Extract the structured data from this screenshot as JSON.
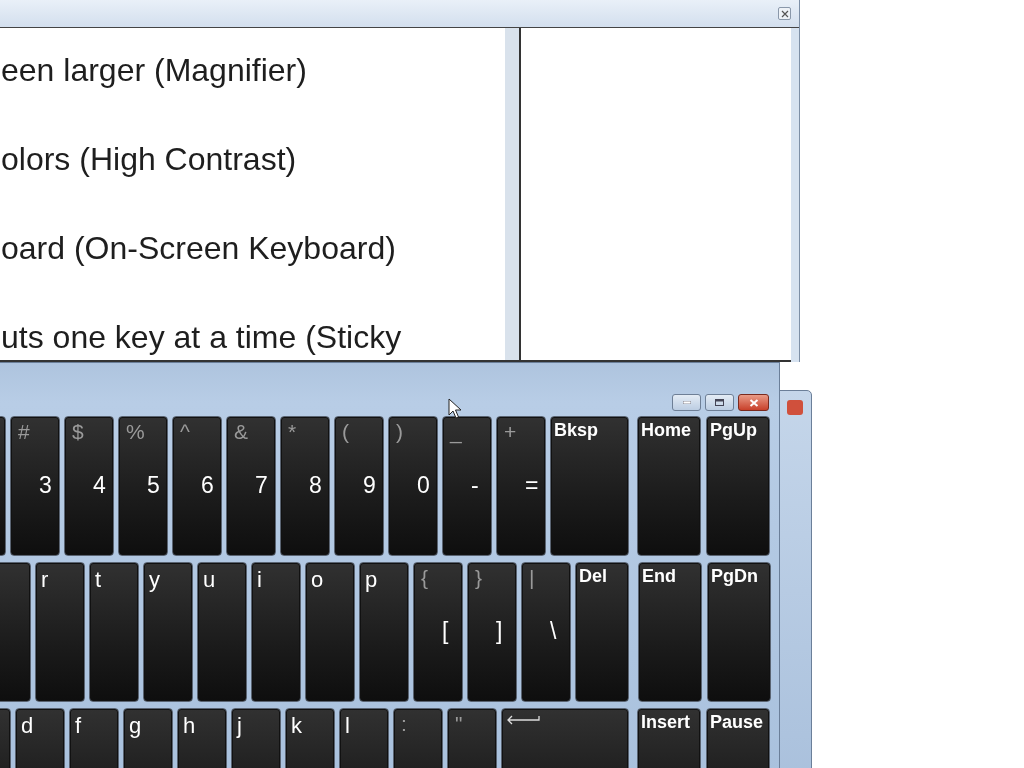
{
  "ease_window": {
    "options": [
      {
        "label": "een larger (Magnifier)"
      },
      {
        "label": "olors (High Contrast)"
      },
      {
        "label": "oard (On-Screen Keyboard)"
      },
      {
        "label": "uts one key at a time (Sticky"
      }
    ]
  },
  "keyboard_window": {
    "rows": [
      {
        "keys": [
          {
            "kind": "blank"
          },
          {
            "kind": "symbol",
            "shift": "#",
            "label": "3"
          },
          {
            "kind": "symbol",
            "shift": "$",
            "label": "4"
          },
          {
            "kind": "symbol",
            "shift": "%",
            "label": "5"
          },
          {
            "kind": "symbol",
            "shift": "^",
            "label": "6"
          },
          {
            "kind": "symbol",
            "shift": "&",
            "label": "7"
          },
          {
            "kind": "symbol",
            "shift": "*",
            "label": "8"
          },
          {
            "kind": "symbol",
            "shift": "(",
            "label": "9"
          },
          {
            "kind": "symbol",
            "shift": ")",
            "label": "0"
          },
          {
            "kind": "symbol",
            "shift": "_",
            "label": "-"
          },
          {
            "kind": "symbol",
            "shift": "+",
            "label": "="
          },
          {
            "kind": "function",
            "label": "Bksp"
          }
        ],
        "nav": [
          {
            "kind": "function",
            "label": "Home"
          },
          {
            "kind": "function",
            "label": "PgUp"
          }
        ]
      },
      {
        "keys": [
          {
            "kind": "blank"
          },
          {
            "kind": "letter",
            "label": "r"
          },
          {
            "kind": "letter",
            "label": "t"
          },
          {
            "kind": "letter",
            "label": "y"
          },
          {
            "kind": "letter",
            "label": "u"
          },
          {
            "kind": "letter",
            "label": "i"
          },
          {
            "kind": "letter",
            "label": "o"
          },
          {
            "kind": "letter",
            "label": "p"
          },
          {
            "kind": "symbol",
            "shift": "{",
            "label": "["
          },
          {
            "kind": "symbol",
            "shift": "}",
            "label": "]"
          },
          {
            "kind": "symbol",
            "shift": "|",
            "label": "\\"
          },
          {
            "kind": "function",
            "label": "Del"
          }
        ],
        "nav": [
          {
            "kind": "function",
            "label": "End"
          },
          {
            "kind": "function",
            "label": "PgDn"
          }
        ]
      },
      {
        "keys": [
          {
            "kind": "blank"
          },
          {
            "kind": "letter",
            "label": "d"
          },
          {
            "kind": "letter",
            "label": "f"
          },
          {
            "kind": "letter",
            "label": "g"
          },
          {
            "kind": "letter",
            "label": "h"
          },
          {
            "kind": "letter",
            "label": "j"
          },
          {
            "kind": "letter",
            "label": "k"
          },
          {
            "kind": "letter",
            "label": "l"
          },
          {
            "kind": "shift_only",
            "shift": ":"
          },
          {
            "kind": "shift_only",
            "shift": "\""
          },
          {
            "kind": "enter"
          }
        ],
        "nav": [
          {
            "kind": "function",
            "label": "Insert"
          },
          {
            "kind": "function",
            "label": "Pause"
          }
        ]
      }
    ]
  }
}
